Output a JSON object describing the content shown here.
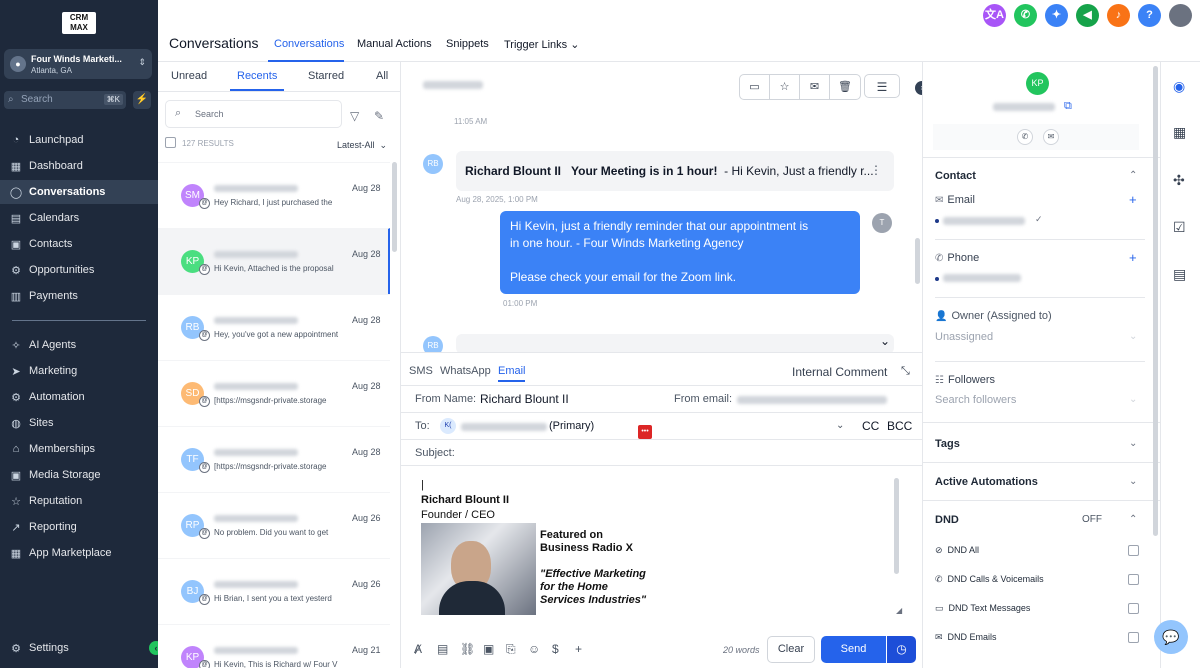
{
  "brand": {
    "logo_text": "CRM MAX"
  },
  "account": {
    "name": "Four Winds Marketi...",
    "location": "Atlanta, GA",
    "avatar_icon": "pin-icon"
  },
  "nav_search": {
    "placeholder": "Search",
    "shortcut": "⌘K"
  },
  "nav": {
    "items": [
      {
        "label": "Launchpad",
        "icon": "rocket-icon",
        "active": false
      },
      {
        "label": "Dashboard",
        "icon": "grid-icon",
        "active": false
      },
      {
        "label": "Conversations",
        "icon": "chat-icon",
        "active": true
      },
      {
        "label": "Calendars",
        "icon": "calendar-icon",
        "active": false
      },
      {
        "label": "Contacts",
        "icon": "contacts-icon",
        "active": false
      },
      {
        "label": "Opportunities",
        "icon": "funnel-icon",
        "active": false
      },
      {
        "label": "Payments",
        "icon": "payments-icon",
        "active": false
      },
      {
        "label": "AI Agents",
        "icon": "sparkle-icon",
        "active": false
      },
      {
        "label": "Marketing",
        "icon": "send-icon",
        "active": false
      },
      {
        "label": "Automation",
        "icon": "automation-icon",
        "active": false
      },
      {
        "label": "Sites",
        "icon": "globe-icon",
        "active": false
      },
      {
        "label": "Memberships",
        "icon": "graduation-icon",
        "active": false
      },
      {
        "label": "Media Storage",
        "icon": "image-icon",
        "active": false
      },
      {
        "label": "Reputation",
        "icon": "star-icon",
        "active": false
      },
      {
        "label": "Reporting",
        "icon": "trend-icon",
        "active": false
      },
      {
        "label": "App Marketplace",
        "icon": "apps-icon",
        "active": false
      }
    ],
    "settings_label": "Settings"
  },
  "header": {
    "title": "Conversations",
    "tabs": [
      {
        "label": "Conversations",
        "active": true
      },
      {
        "label": "Manual Actions",
        "active": false
      },
      {
        "label": "Snippets",
        "active": false
      },
      {
        "label": "Trigger Links",
        "active": false
      }
    ]
  },
  "top_icons": [
    {
      "name": "translate-icon",
      "glyph": "文A",
      "color": "#a855f7"
    },
    {
      "name": "phone-icon",
      "glyph": "✆",
      "color": "#22c55e"
    },
    {
      "name": "magic-icon",
      "glyph": "✦",
      "color": "#3b82f6"
    },
    {
      "name": "megaphone-icon",
      "glyph": "◀",
      "color": "#16a34a"
    },
    {
      "name": "bell-icon",
      "glyph": "♪",
      "color": "#f97316"
    },
    {
      "name": "help-icon",
      "glyph": "?",
      "color": "#3b82f6"
    },
    {
      "name": "user-avatar-icon",
      "glyph": "",
      "color": "#6b7280"
    }
  ],
  "list": {
    "tabs": [
      {
        "label": "Unread",
        "active": false
      },
      {
        "label": "Recents",
        "active": true
      },
      {
        "label": "Starred",
        "active": false
      },
      {
        "label": "All",
        "active": false
      }
    ],
    "search_placeholder": "Search",
    "results": "127 RESULTS",
    "sort": "Latest-All",
    "conversations": [
      {
        "initials": "SM",
        "color": "#c084fc",
        "date": "Aug 28",
        "preview": "Hey Richard,  I just purchased the",
        "selected": false
      },
      {
        "initials": "KP",
        "color": "#4ade80",
        "date": "Aug 28",
        "preview": "Hi Kevin, Attached is the proposal",
        "selected": true
      },
      {
        "initials": "RB",
        "color": "#93c5fd",
        "date": "Aug 28",
        "preview": "Hey, you've got a new appointment",
        "selected": false
      },
      {
        "initials": "SD",
        "color": "#fdba74",
        "date": "Aug 28",
        "preview": "[https://msgsndr-private.storage",
        "selected": false
      },
      {
        "initials": "TF",
        "color": "#93c5fd",
        "date": "Aug 28",
        "preview": "[https://msgsndr-private.storage",
        "selected": false
      },
      {
        "initials": "RP",
        "color": "#93c5fd",
        "date": "Aug 26",
        "preview": "No problem. Did you want to get",
        "selected": false
      },
      {
        "initials": "BJ",
        "color": "#93c5fd",
        "date": "Aug 26",
        "preview": "Hi Brian, I sent you a text yesterd",
        "selected": false
      },
      {
        "initials": "KP",
        "color": "#c084fc",
        "date": "Aug 21",
        "preview": "Hi Kevin, This is Richard w/ Four V",
        "selected": false
      }
    ]
  },
  "thread": {
    "time1": "11:05 AM",
    "incoming": {
      "initials": "RB",
      "sender": "Richard Blount II",
      "subject": "Your Meeting is in 1 hour!",
      "snippet": "-  Hi Kevin, Just a friendly r..."
    },
    "time2": "Aug 28, 2025, 1:00 PM",
    "outgoing": {
      "line1": "Hi Kevin, just a friendly reminder that our appointment is",
      "line2": "in one hour. - Four Winds Marketing Agency",
      "line3": "Please check your email for the Zoom link."
    },
    "out_avatar": "T",
    "time3": "01:00 PM",
    "next_initials": "RB"
  },
  "composer": {
    "tabs": [
      {
        "label": "SMS",
        "active": false
      },
      {
        "label": "WhatsApp",
        "active": false
      },
      {
        "label": "Email",
        "active": true
      }
    ],
    "internal_comment": "Internal Comment",
    "from_name_label": "From Name:",
    "from_name": "Richard Blount II",
    "from_email_label": "From email:",
    "to_label": "To:",
    "to_initials": "K(",
    "to_suffix": "(Primary)",
    "cc": "CC",
    "bcc": "BCC",
    "subject_label": "Subject:",
    "signature": {
      "name": "Richard Blount II",
      "role": "Founder / CEO",
      "featured1": "Featured on",
      "featured2": "Business Radio X",
      "quote1": "\"Effective Marketing",
      "quote2": "for the Home",
      "quote3": "Services Industries\""
    },
    "words": "20 words",
    "clear": "Clear",
    "send": "Send"
  },
  "contact_panel": {
    "avatar": "KP",
    "contact_header": "Contact",
    "email_label": "Email",
    "phone_label": "Phone",
    "owner_label": "Owner (Assigned to)",
    "owner_value": "Unassigned",
    "followers_label": "Followers",
    "followers_placeholder": "Search followers",
    "tags": "Tags",
    "active_automations": "Active Automations",
    "dnd": "DND",
    "dnd_state": "OFF",
    "dnd_items": [
      {
        "label": "DND All",
        "icon": "block-icon"
      },
      {
        "label": "DND Calls & Voicemails",
        "icon": "phone-icon"
      },
      {
        "label": "DND Text Messages",
        "icon": "message-icon"
      },
      {
        "label": "DND Emails",
        "icon": "mail-icon"
      }
    ]
  }
}
